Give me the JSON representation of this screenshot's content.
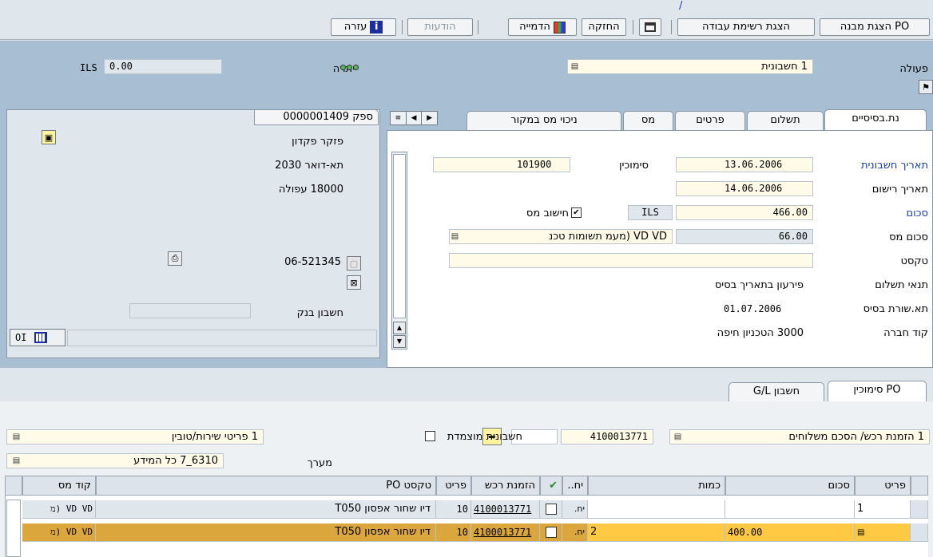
{
  "top_link": "/",
  "toolbar": {
    "po_structure": "הצגת מבנה PO",
    "worklist": "הצגת רשימת עבודה",
    "hold": "החזקה",
    "simulate": "הדמייה",
    "messages": "הודעות",
    "help": "עזרה"
  },
  "header": {
    "action_label": "פעולה",
    "action_value": "1 חשבונית",
    "balance_label": "יתרה",
    "balance_amount": "0.00",
    "balance_currency": "ILS"
  },
  "tabs": [
    "נת.בסיסיים",
    "תשלום",
    "פרטים",
    "מס",
    "ניכוי מס במקור"
  ],
  "basic": {
    "invoice_date_label": "תאריך חשבונית",
    "invoice_date": "13.06.2006",
    "reference_label": "סימוכין",
    "reference": "101900",
    "posting_date_label": "תאריך רישום",
    "posting_date": "14.06.2006",
    "amount_label": "סכום",
    "amount": "466.00",
    "currency": "ILS",
    "calc_tax_label": "חישוב מס",
    "tax_amount_label": "סכום מס",
    "tax_amount": "66.00",
    "tax_code": "VD VD (מעמ תשומות טכנ",
    "text_label": "טקסט",
    "text_value": "",
    "payment_terms_label": "תנאי תשלום",
    "payment_terms": "פירעון בתאריך בסיס",
    "baseline_date_label": "תא.שורת בסיס",
    "baseline_date": "01.07.2006",
    "company_code_label": "קוד חברה",
    "company_code": "3000 הטכניון חיפה"
  },
  "vendor": {
    "header": "ספק 0000001409",
    "name": "פזקר פקדון",
    "pobox": "תא-דואר 2030",
    "city": "18000 עפולה",
    "phone": "06-521345",
    "bank_label": "חשבון בנק",
    "oi_label": "OI"
  },
  "po_tabs": {
    "po_reference": "PO סימוכין",
    "gl_account": "חשבון G/L"
  },
  "po_ref": {
    "doc_type": "1 הזמנת רכש/ הסכם משלוחים",
    "po_number": "4100013771",
    "item_type": "1 פריטי שירות/טובין",
    "consolidated_label": "חשבונית מוצמדת",
    "layout_label": "מערך",
    "layout_value": "6310_7 כל המידע"
  },
  "grid": {
    "columns": [
      "פריט",
      "סכום",
      "כמות",
      "יח..",
      "",
      "הזמנת רכש",
      "פריט",
      "טקסט PO",
      "קוד מס"
    ],
    "rows": [
      {
        "item": "1",
        "amount": "",
        "qty": "",
        "unit": "יח.",
        "po": "4100013771",
        "po_item": "10",
        "text": "דיו שחור אפסון T050",
        "tax": "VD VD (מ"
      },
      {
        "item": "",
        "amount": "400.00",
        "qty": "2",
        "unit": "יח.",
        "po": "4100013771",
        "po_item": "10",
        "text": "דיו שחור אפסון T050",
        "tax": "VD VD (מ"
      }
    ]
  },
  "colors": {
    "accent_band": "#a7bed3",
    "highlight_row": "#ffc944",
    "link": "#1a3fa8"
  }
}
